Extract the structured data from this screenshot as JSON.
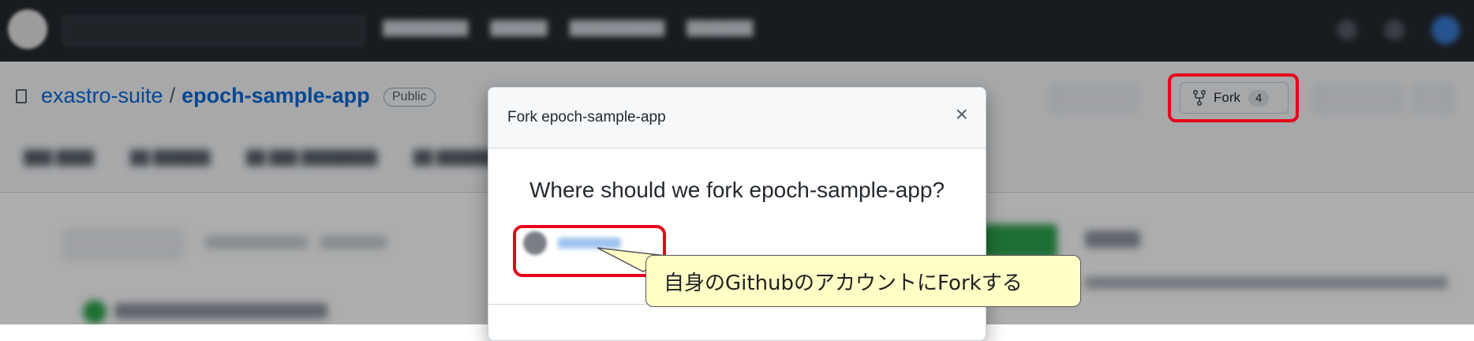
{
  "repo": {
    "owner": "exastro-suite",
    "separator": "/",
    "name": "epoch-sample-app",
    "visibility_badge": "Public"
  },
  "fork": {
    "label": "Fork",
    "count": "4"
  },
  "modal": {
    "title": "Fork epoch-sample-app",
    "close_symbol": "×",
    "question": "Where should we fork epoch-sample-app?"
  },
  "annotation": {
    "callout_text": "自身のGithubのアカウントにForkする",
    "highlight_color": "#e8001c",
    "callout_bg": "#ffffc6"
  }
}
